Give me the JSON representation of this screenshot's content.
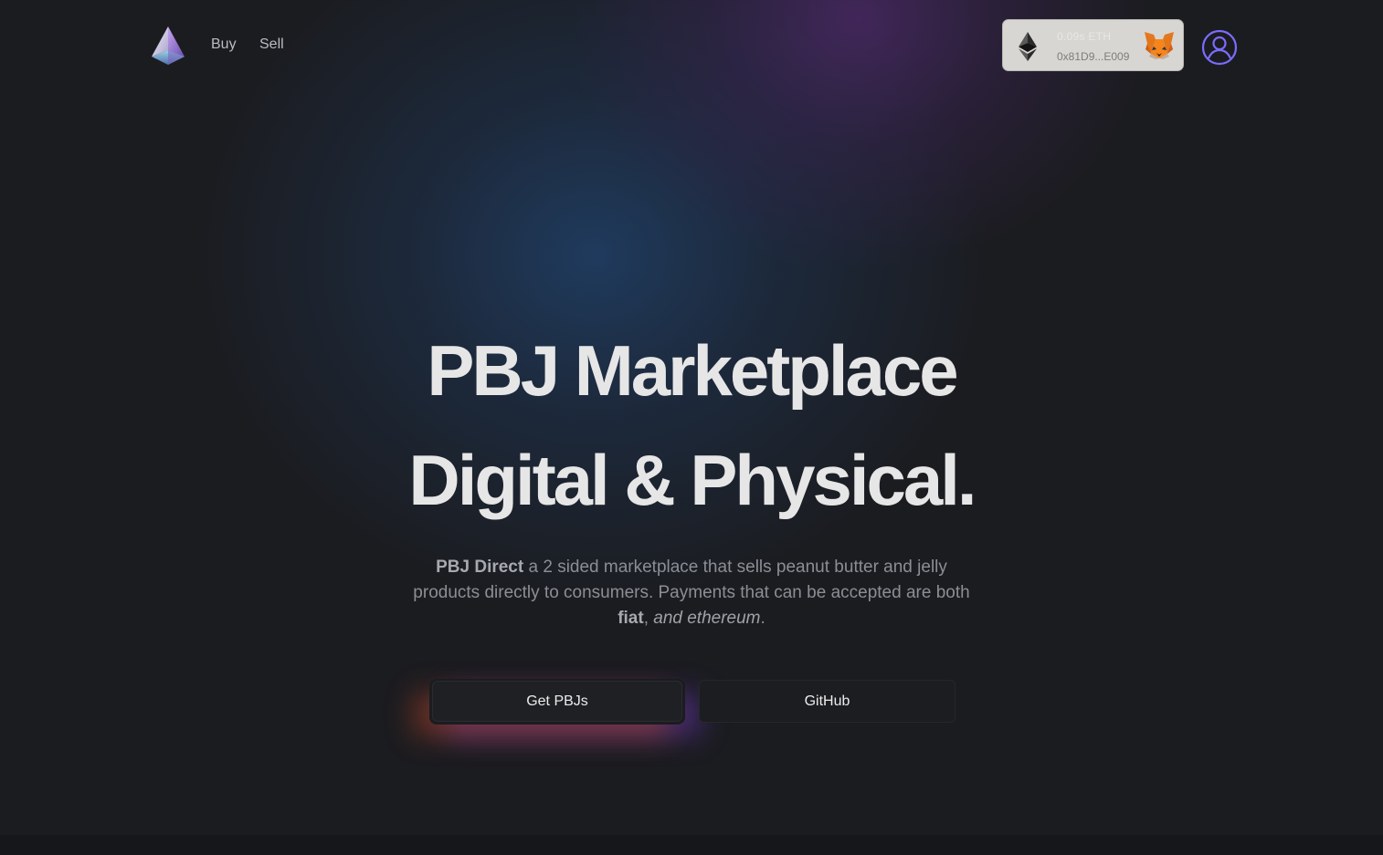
{
  "nav": {
    "buy_label": "Buy",
    "sell_label": "Sell",
    "logo_icon": "prism-logo-icon"
  },
  "wallet": {
    "balance": "0.09s ETH",
    "address": "0x81D9...E009",
    "currency_icon": "ethereum-icon",
    "provider_icon": "metamask-fox-icon"
  },
  "profile": {
    "icon": "user-circle-icon",
    "accent": "#7b6cff"
  },
  "hero": {
    "title_line1": "PBJ Marketplace",
    "title_line2": "Digital & Physical.",
    "desc_brand": "PBJ Direct",
    "desc_text1": " a 2 sided marketplace that sells peanut butter and jelly products directly to consumers. Payments that can be accepted are both ",
    "desc_fiat": "fiat",
    "desc_sep": ", ",
    "desc_eth": "and ethereum",
    "desc_end": "."
  },
  "buttons": {
    "primary_label": "Get PBJs",
    "secondary_label": "GitHub"
  }
}
